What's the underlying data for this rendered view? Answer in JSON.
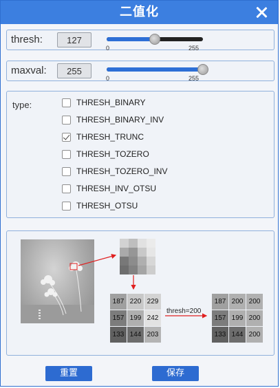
{
  "window": {
    "title": "二值化"
  },
  "thresh": {
    "label": "thresh:",
    "value": "127",
    "fraction": 0.498,
    "min": "0",
    "max": "255"
  },
  "maxval": {
    "label": "maxval:",
    "value": "255",
    "fraction": 1.0,
    "min": "0",
    "max": "255"
  },
  "type": {
    "label": "type:",
    "options": [
      {
        "label": "THRESH_BINARY",
        "checked": false
      },
      {
        "label": "THRESH_BINARY_INV",
        "checked": false
      },
      {
        "label": "THRESH_TRUNC",
        "checked": true
      },
      {
        "label": "THRESH_TOZERO",
        "checked": false
      },
      {
        "label": "THRESH_TOZERO_INV",
        "checked": false
      },
      {
        "label": "THRESH_INV_OTSU",
        "checked": false
      },
      {
        "label": "THRESH_OTSU",
        "checked": false
      }
    ]
  },
  "illustration": {
    "arrow_label": "thresh=200",
    "before": [
      [
        "187",
        "220",
        "229"
      ],
      [
        "157",
        "199",
        "242"
      ],
      [
        "133",
        "144",
        "203"
      ]
    ],
    "after": [
      [
        "187",
        "200",
        "200"
      ],
      [
        "157",
        "199",
        "200"
      ],
      [
        "133",
        "144",
        "200"
      ]
    ],
    "colors": {
      "arrow": "#e02020"
    }
  },
  "buttons": {
    "reset": "重置",
    "save": "保存"
  }
}
